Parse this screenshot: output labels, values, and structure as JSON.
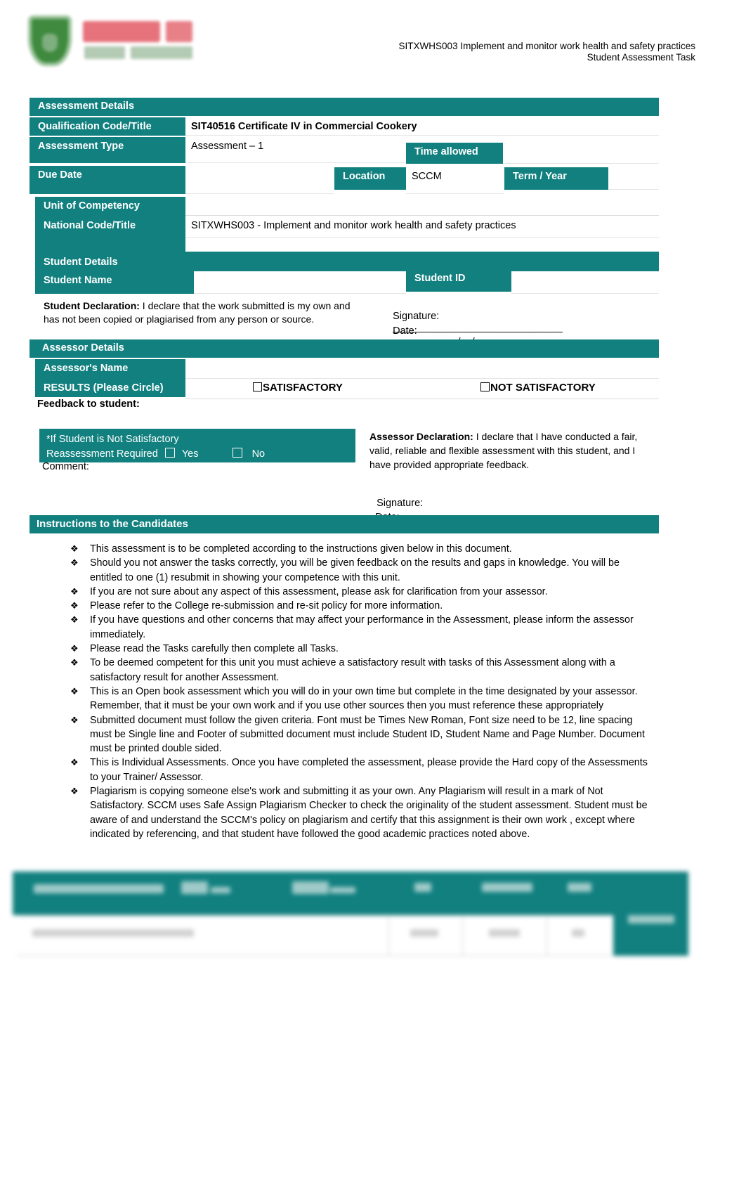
{
  "header": {
    "unit_line": "SITXWHS003 Implement and monitor work health and safety practices",
    "doc_line": "Student Assessment Task",
    "logo_name": "college-logo"
  },
  "assessment_details": {
    "banner": "Assessment Details",
    "qualification_label": "Qualification Code/Title",
    "qualification_value": "SIT40516 Certificate IV in Commercial Cookery",
    "type_label": "Assessment Type",
    "type_value": "Assessment – 1",
    "time_allowed_label": "Time allowed",
    "time_allowed_value": "",
    "due_date_label": "Due Date",
    "due_date_value": "",
    "location_label": "Location",
    "location_value": "SCCM",
    "term_year_label": "Term / Year",
    "term_year_value": ""
  },
  "unit_of_competency": {
    "label_line1": "Unit of Competency",
    "label_line2": "National Code/Title",
    "value": "SITXWHS003 - Implement and monitor work health and safety practices"
  },
  "student_details": {
    "banner": "Student Details",
    "name_label": "Student Name",
    "name_value": "",
    "id_label": "Student ID",
    "id_value": "",
    "declaration_bold": "Student Declaration:",
    "declaration_text": " I declare that the work submitted is my own and has not been copied or plagiarised from any person or source.",
    "signature_label": "Signature:",
    "signature_line": "______________________________",
    "date_label": "Date:",
    "date_line": "______/__/__________"
  },
  "assessor_details": {
    "banner": "Assessor Details",
    "name_label": "Assessor's Name",
    "name_value": "",
    "results_label": "RESULTS (Please Circle)",
    "result_option_satisfactory": "SATISFACTORY",
    "result_option_not_satisfactory": "NOT SATISFACTORY",
    "feedback_label": "Feedback to student:",
    "feedback_value": ""
  },
  "reassessment": {
    "note_line1": "*If Student is Not Satisfactory",
    "note_line2": "Reassessment Required",
    "yes_label": "Yes",
    "no_label": "No",
    "comment_label": "Comment:",
    "comment_value": ""
  },
  "assessor_declaration": {
    "bold": "Assessor Declaration:",
    "text": "  I declare that I have conducted a fair, valid, reliable and flexible assessment with this student, and I have provided appropriate feedback.",
    "signature_label": "Signature:",
    "signature_line": "_______________________",
    "date_label": "Date:",
    "date_line": "______/_______/__________"
  },
  "instructions": {
    "banner": "Instructions to the Candidates",
    "bullet_glyph": "❖",
    "items": [
      "This assessment is to be completed according to the instructions given below in this document.",
      "Should you not answer the tasks correctly, you will be given feedback on the results and gaps in knowledge. You will be entitled to one (1) resubmit in showing your competence with this unit.",
      "If you are not sure about any aspect of this assessment, please ask for clarification from your assessor.",
      "Please refer to the College re-submission and re-sit policy for more information.",
      "If you have questions and other concerns that may affect your performance in the Assessment, please inform the assessor immediately.",
      "Please read the Tasks carefully then complete all Tasks.",
      "To be deemed competent for this unit you must achieve a satisfactory result with tasks of this Assessment along with a satisfactory result for another Assessment.",
      "This is an Open book assessment which you will do in your own time but complete in the time designated by your assessor. Remember, that it must be your own work and if you use other sources then you must reference these appropriately",
      "Submitted document must follow the given criteria. Font must be Times New Roman, Font size need to be 12, line spacing must be Single line and Footer of submitted document must include Student ID, Student Name and Page Number. Document must be printed double sided.",
      "This is Individual Assessments. Once you have completed the assessment, please provide the Hard copy of the Assessments to your Trainer/ Assessor.",
      "Plagiarism is copying someone else's work and submitting it as your own. Any Plagiarism will result in a mark of Not Satisfactory. SCCM uses Safe Assign Plagiarism Checker to check the originality of the student assessment. Student must be aware of and understand the SCCM's policy on plagiarism and certify that this assignment is their own work , except where indicated by referencing, and that student have followed the good academic practices noted above."
    ]
  },
  "footer": {
    "note": "obscured-footer-table",
    "page_label": ""
  },
  "colors": {
    "teal": "#11807f",
    "white": "#ffffff",
    "black": "#000000"
  }
}
